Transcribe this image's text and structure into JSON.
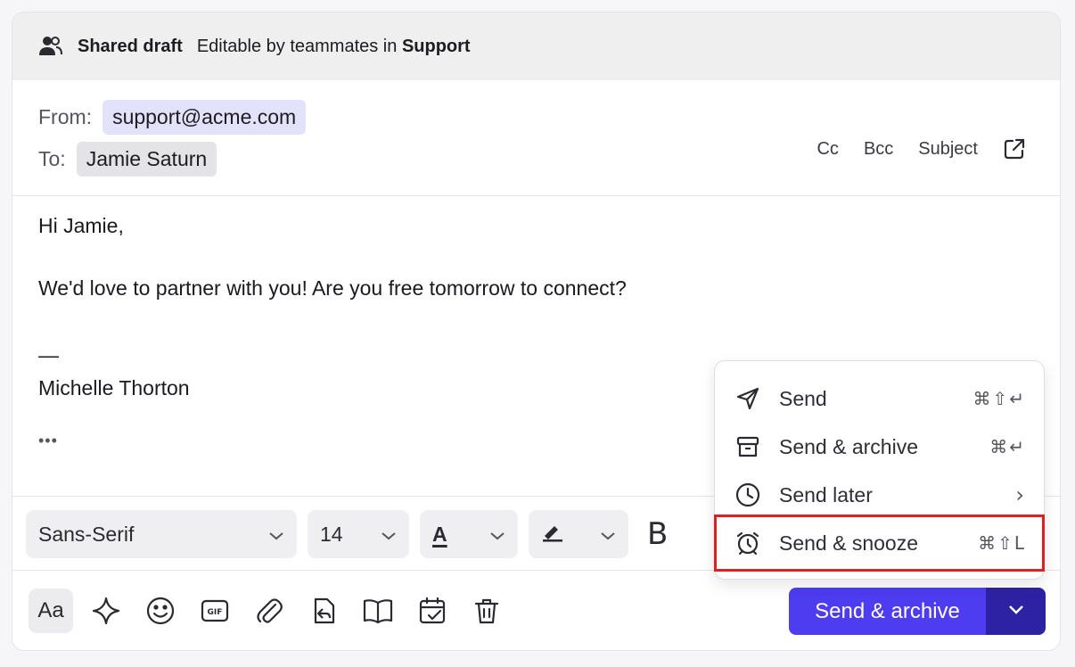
{
  "banner": {
    "title": "Shared draft",
    "subtitle_prefix": "Editable by teammates in ",
    "subtitle_team": "Support",
    "icon": "users-icon"
  },
  "header": {
    "from_label": "From:",
    "from_value": "support@acme.com",
    "to_label": "To:",
    "to_value": "Jamie Saturn",
    "cc": "Cc",
    "bcc": "Bcc",
    "subject": "Subject",
    "popout_icon": "external-link-icon"
  },
  "message": {
    "greeting": "Hi Jamie,",
    "line1": "We'd love to partner with you! Are you free tomorrow to connect?",
    "sig_dash": "—",
    "signature": "Michelle Thorton",
    "ellipsis": "•••"
  },
  "format_bar": {
    "font_family": "Sans-Serif",
    "font_size": "14",
    "text_color_label": "A",
    "bold_label": "B"
  },
  "toolbar": {
    "aa_label": "Aa",
    "icons": [
      "sparkle-icon",
      "emoji-icon",
      "gif-icon",
      "paperclip-icon",
      "template-icon",
      "book-icon",
      "calendar-check-icon",
      "trash-icon"
    ],
    "gif_text": "GIF"
  },
  "send_button": {
    "label": "Send & archive"
  },
  "send_menu": {
    "items": [
      {
        "label": "Send",
        "shortcut": "⌘⇧↵",
        "icon": "paper-plane-icon"
      },
      {
        "label": "Send & archive",
        "shortcut": "⌘↵",
        "icon": "archive-box-icon"
      },
      {
        "label": "Send later",
        "shortcut": "›",
        "icon": "clock-icon"
      },
      {
        "label": "Send & snooze",
        "shortcut": "⌘⇧L",
        "icon": "alarm-clock-icon"
      }
    ],
    "highlighted_index": 3
  },
  "colors": {
    "accent": "#4d3cf0",
    "accent_dark": "#2e22a4",
    "from_chip": "#e3e2fb",
    "highlight_border": "#e02020"
  }
}
